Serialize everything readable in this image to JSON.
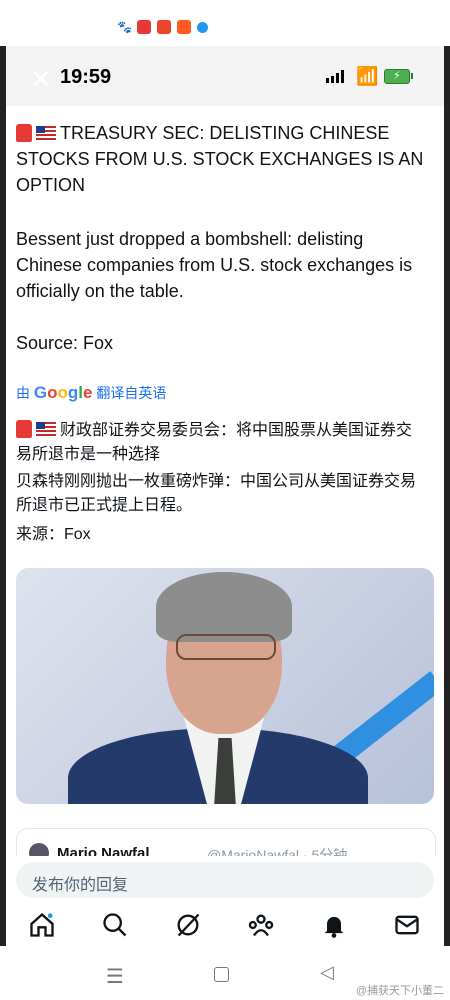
{
  "status_bar": {
    "time": "19:59"
  },
  "post": {
    "title_line1": "TREASURY SEC: DELISTING CHINESE",
    "title_line2": "STOCKS FROM U.S. STOCK EXCHANGES IS AN",
    "title_line3": "OPTION",
    "body_line1": "Bessent just dropped a bombshell: delisting",
    "body_line2": "Chinese companies from U.S. stock exchanges is",
    "body_line3": "officially on the table.",
    "source": "Source: Fox",
    "translate_prefix": "由",
    "translate_brand": "Google",
    "translate_suffix": "翻译自英语",
    "zh_title_line1": "财政部证券交易委员会：将中国股票从美国证券交",
    "zh_title_line2": "易所退市是一种选择",
    "zh_body_line1": "贝森特刚刚抛出一枚重磅炸弹：中国公司从美国证券交易",
    "zh_body_line2": "所退市已正式提上日程。",
    "zh_source": "来源：Fox"
  },
  "quote_card": {
    "name": "Mario Nawfal",
    "meta": "@MarioNawfal · 5分钟"
  },
  "reply": {
    "placeholder": "发布你的回复"
  },
  "watermark": "@捕获天下小董二",
  "icons": [
    "close-icon",
    "search-icon",
    "grok-icon",
    "communities-icon",
    "bell-icon",
    "mail-icon",
    "home-icon"
  ]
}
